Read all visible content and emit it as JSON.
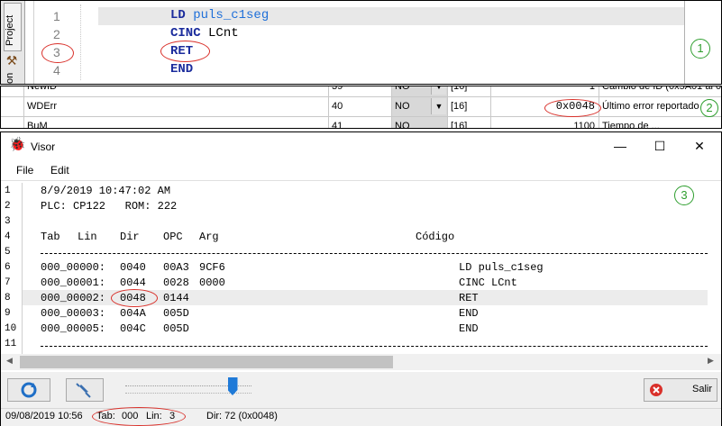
{
  "editor": {
    "sidebar_tab": "Project",
    "sidebar_tab2": "on",
    "lines": [
      {
        "num": "1",
        "kw": "LD",
        "arg": "puls_c1seg"
      },
      {
        "num": "2",
        "kw": "CINC",
        "arg": "LCnt"
      },
      {
        "num": "3",
        "kw": "RET",
        "arg": ""
      },
      {
        "num": "4",
        "kw": "END",
        "arg": ""
      }
    ],
    "marker": "1"
  },
  "table": {
    "rows": [
      {
        "name": "NewID",
        "num": "39",
        "sel": "NO",
        "type": "[16]",
        "value": "1",
        "desc": "Cambio de ID (0x5A01 al 0x"
      },
      {
        "name": "WDErr",
        "num": "40",
        "sel": "NO",
        "type": "[16]",
        "value": "0x0048",
        "desc": "Último error reportado"
      },
      {
        "name": "BuM",
        "num": "41",
        "sel": "NO",
        "type": "[16]",
        "value": "1100",
        "desc": "Tiempo de ..."
      }
    ],
    "marker": "2"
  },
  "visor": {
    "title": "Visor",
    "window_controls": {
      "minimize": "—",
      "maximize": "☐",
      "close": "✕"
    },
    "menu": [
      "File",
      "Edit"
    ],
    "line_numbers": [
      "1",
      "2",
      "3",
      "4",
      "5",
      "6",
      "7",
      "8",
      "9",
      "10",
      "11"
    ],
    "header_lines": [
      "8/9/2019 10:47:02 AM",
      "PLC: CP122   ROM: 222"
    ],
    "columns": {
      "tab": "Tab",
      "lin": "Lin",
      "dir": "Dir",
      "opc": "OPC",
      "arg": "Arg",
      "code": "Código"
    },
    "rows": [
      {
        "addr": "000_00000:",
        "dir": "0040",
        "opc": "00A3",
        "arg": "9CF6",
        "code": "LD puls_c1seg"
      },
      {
        "addr": "000_00001:",
        "dir": "0044",
        "opc": "0028",
        "arg": "0000",
        "code": "CINC LCnt"
      },
      {
        "addr": "000_00002:",
        "dir": "0048",
        "opc": "0144",
        "arg": "",
        "code": "RET"
      },
      {
        "addr": "000_00003:",
        "dir": "004A",
        "opc": "005D",
        "arg": "",
        "code": "END"
      },
      {
        "addr": "000_00005:",
        "dir": "004C",
        "opc": "005D",
        "arg": "",
        "code": "END"
      }
    ],
    "marker": "3",
    "exit_label": "Salir",
    "slider_value_fraction": 0.85,
    "status": {
      "datetime": "09/08/2019 10:56",
      "tab_label": "Tab:",
      "tab_value": "000",
      "lin_label": "Lin:",
      "lin_value": "3",
      "dir": "Dir: 72 (0x0048)"
    }
  }
}
